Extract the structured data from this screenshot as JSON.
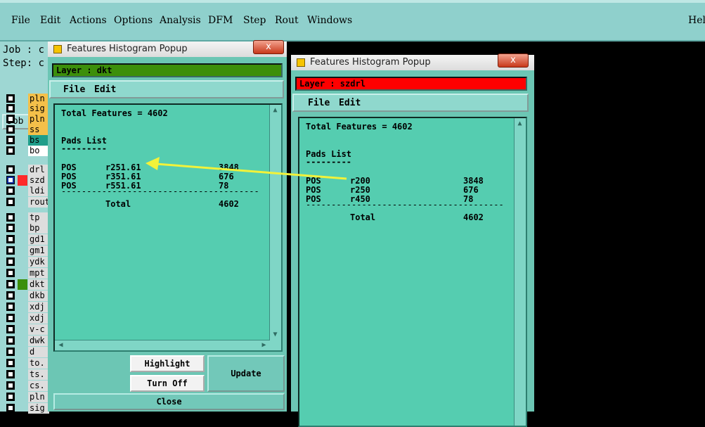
{
  "menubar": {
    "items": [
      "File",
      "Edit",
      "Actions",
      "Options",
      "Analysis",
      "DFM",
      "Step",
      "Rout",
      "Windows"
    ],
    "help": "Hel"
  },
  "leftpanel": {
    "job_line": "Job : c",
    "step_line": "Step: c",
    "job_manager": "Job Ma",
    "layers": [
      {
        "name": "pln",
        "color": "#f4c04a"
      },
      {
        "name": "sig",
        "color": "#f4c04a"
      },
      {
        "name": "pln",
        "color": "#f4c04a"
      },
      {
        "name": "ss",
        "color": "#f4c04a"
      },
      {
        "name": "bs",
        "color": "#1f9e8a"
      },
      {
        "name": "bo",
        "color": "#ffffff"
      },
      {
        "name": "drl",
        "color": "#dddddd"
      },
      {
        "name": "szd",
        "color": "#dddddd"
      },
      {
        "name": "ldi",
        "color": "#dddddd"
      },
      {
        "name": "rout",
        "color": "#dddddd"
      },
      {
        "name": "tp",
        "color": "#dddddd"
      },
      {
        "name": "bp",
        "color": "#dddddd"
      },
      {
        "name": "gd1",
        "color": "#dddddd"
      },
      {
        "name": "gm1",
        "color": "#dddddd"
      },
      {
        "name": "ydk",
        "color": "#dddddd"
      },
      {
        "name": "mpt",
        "color": "#dddddd"
      },
      {
        "name": "dkt",
        "color": "#dddddd"
      },
      {
        "name": "dkb",
        "color": "#dddddd"
      },
      {
        "name": "xdj",
        "color": "#dddddd"
      },
      {
        "name": "xdj",
        "color": "#dddddd"
      },
      {
        "name": "v-c",
        "color": "#dddddd"
      },
      {
        "name": "dwk",
        "color": "#dddddd"
      },
      {
        "name": "d",
        "color": "#dddddd"
      },
      {
        "name": "to.",
        "color": "#dddddd"
      },
      {
        "name": "ts.",
        "color": "#dddddd"
      },
      {
        "name": "cs.",
        "color": "#dddddd"
      },
      {
        "name": "pln",
        "color": "#dddddd"
      },
      {
        "name": "sig",
        "color": "#dddddd"
      }
    ]
  },
  "popup_left": {
    "title": "Features Histogram Popup",
    "close_glyph": "x",
    "layer_label": "Layer :  dkt",
    "layer_color": "#3c8f0a",
    "menu": [
      "File",
      "Edit"
    ],
    "total_features": "Total Features = 4602",
    "pads_list": "Pads List",
    "pads_underline": "---------",
    "rows": [
      {
        "type": "POS",
        "sym": "r251.61",
        "count": "3848"
      },
      {
        "type": "POS",
        "sym": "r351.61",
        "count": "676"
      },
      {
        "type": "POS",
        "sym": "r551.61",
        "count": "78"
      }
    ],
    "separator": "---------------------------------------",
    "total_label": "Total",
    "total_value": "4602",
    "buttons": {
      "highlight": "Highlight",
      "turn_off": "Turn Off",
      "update": "Update",
      "close": "Close"
    }
  },
  "popup_right": {
    "title": "Features Histogram Popup",
    "close_glyph": "x",
    "layer_label": "Layer :  szdrl",
    "layer_color": "#ff0000",
    "menu": [
      "File",
      "Edit"
    ],
    "total_features": "Total Features = 4602",
    "pads_list": "Pads List",
    "pads_underline": "---------",
    "rows": [
      {
        "type": "POS",
        "sym": "r200",
        "count": "3848"
      },
      {
        "type": "POS",
        "sym": "r250",
        "count": "676"
      },
      {
        "type": "POS",
        "sym": "r450",
        "count": "78"
      }
    ],
    "separator": "---------------------------------------",
    "total_label": "Total",
    "total_value": "4602"
  },
  "annotation": {
    "arrow_color": "#f2f23a"
  }
}
